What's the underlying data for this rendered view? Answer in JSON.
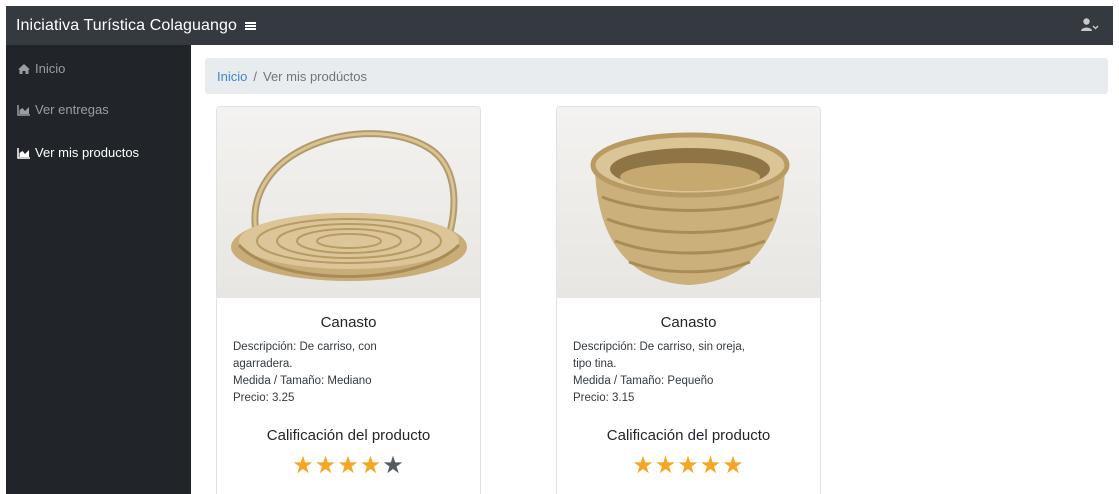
{
  "app": {
    "title": "Iniciativa Turística Colaguango"
  },
  "sidebar": {
    "items": [
      {
        "label": "Inicio",
        "icon": "home-icon",
        "active": false
      },
      {
        "label": "Ver entregas",
        "icon": "area-chart-icon",
        "active": false
      },
      {
        "label": "Ver mis productos",
        "icon": "area-chart-icon",
        "active": true
      }
    ]
  },
  "breadcrumb": {
    "home": "Inicio",
    "separator": "/",
    "current": "Ver mis prodúctos"
  },
  "products": [
    {
      "name": "Canasto",
      "description": "Descripción: De carriso, con agarradera.",
      "size": "Medida / Tamaño: Mediano",
      "price": "Precio: 3.25",
      "rating_title": "Calificación del producto",
      "rating": 4,
      "rating_max": 5,
      "image": "basket-with-handle"
    },
    {
      "name": "Canasto",
      "description": "Descripción: De carriso, sin oreja, tipo tina.",
      "size": "Medida / Tamaño: Pequeño",
      "price": "Precio: 3.15",
      "rating_title": "Calificación del producto",
      "rating": 5,
      "rating_max": 5,
      "image": "tub-basket"
    }
  ],
  "colors": {
    "topbar": "#343a40",
    "sidebar": "#212529",
    "link": "#3f84c9",
    "star": "#f5a623"
  }
}
